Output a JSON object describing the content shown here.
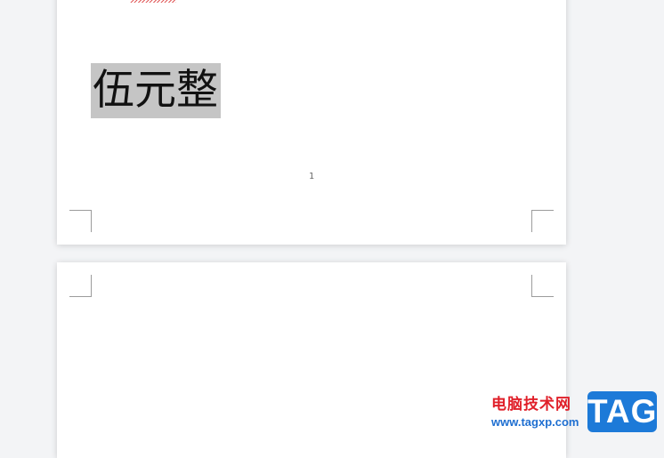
{
  "document": {
    "page1": {
      "selected_text": "伍元整",
      "page_number": "1"
    }
  },
  "watermark": {
    "site_name": "电脑技术网",
    "url": "www.tagxp.com",
    "badge": "TAG"
  }
}
